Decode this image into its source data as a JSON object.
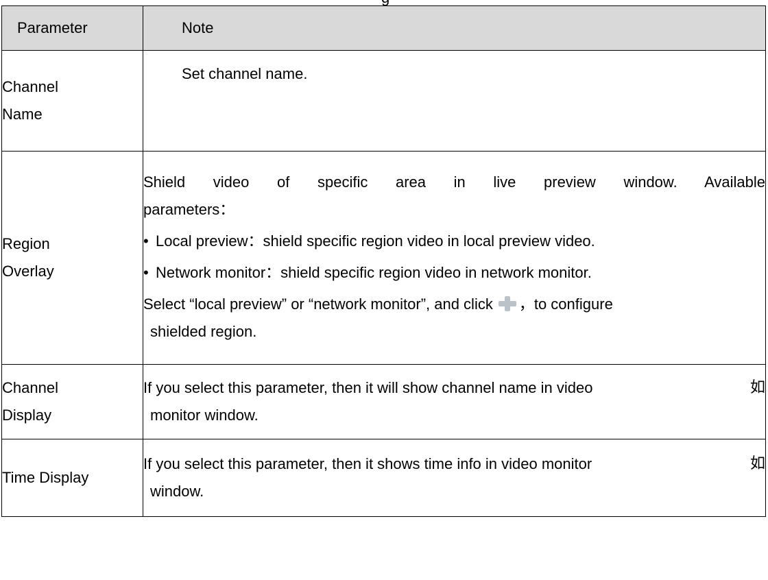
{
  "page": {
    "title_fragment": "g"
  },
  "table": {
    "headers": {
      "parameter": "Parameter",
      "note": "Note"
    },
    "rows": {
      "channel_name": {
        "param_line1": "Channel",
        "param_line2": "Name",
        "note": "Set channel name."
      },
      "region_overlay": {
        "param_line1": "Region",
        "param_line2": "Overlay",
        "note_line1": "Shield video of specific area in live preview window. Available",
        "note_line2": "parameters：",
        "bullet": "•",
        "bullet1": "Local preview：shield specific region video in local preview video.",
        "bullet2": "Network monitor：shield specific region video in network monitor.",
        "select_before": "Select “local preview” or “network monitor”, and click",
        "select_icon": "plus-icon",
        "select_after": "，to configure",
        "select_line2": "shielded region."
      },
      "channel_display": {
        "param_line1": "Channel",
        "param_line2": "Display",
        "note_line1": "If you select this parameter, then it will show channel name in video",
        "trailing_glyph": "如",
        "note_line2": "monitor window."
      },
      "time_display": {
        "param": "Time Display",
        "note_line1": "If you select this parameter, then it shows time info in video monitor",
        "trailing_glyph": "如",
        "note_line2": "window."
      }
    }
  }
}
